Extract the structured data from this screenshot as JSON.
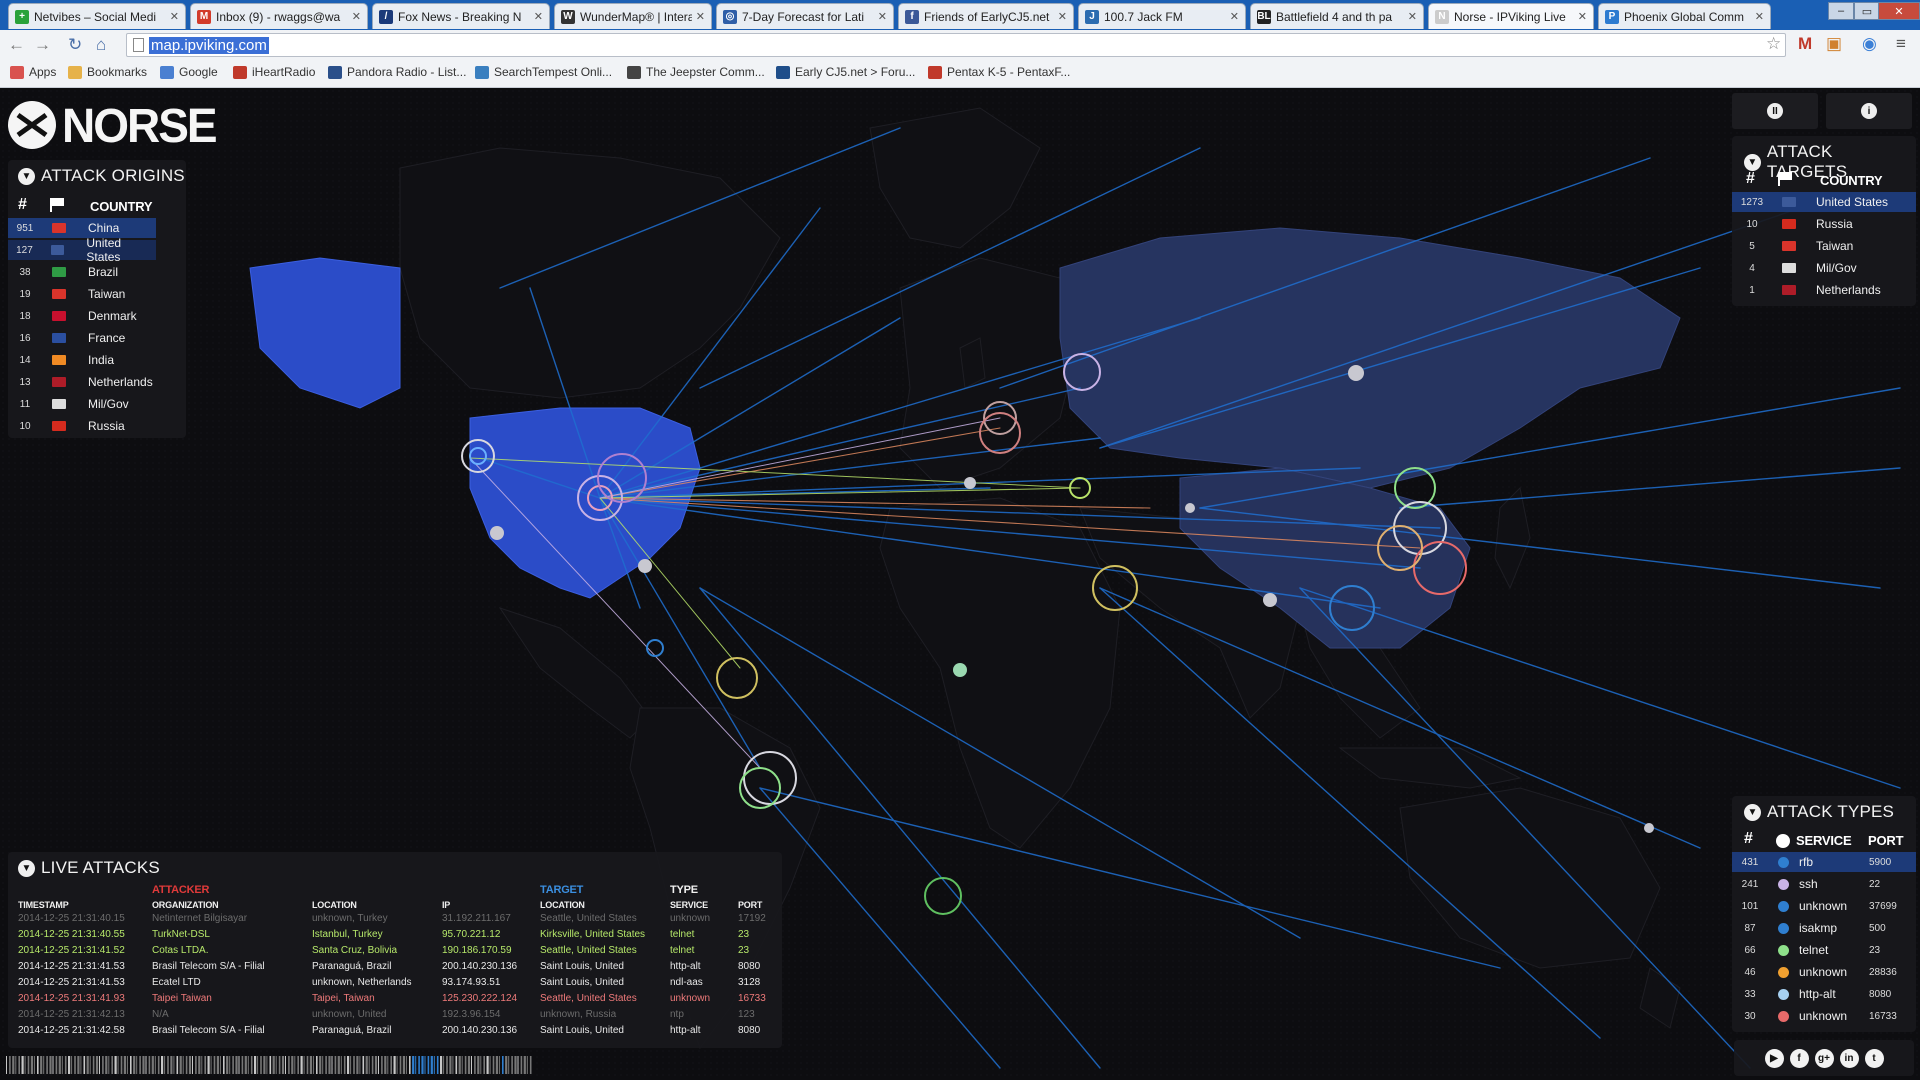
{
  "browser": {
    "tabs": [
      {
        "title": "Netvibes – Social Medi",
        "fav_color": "#2aa23a",
        "fav_glyph": "+"
      },
      {
        "title": "Inbox (9) - rwaggs@wa",
        "fav_color": "#d23b2a",
        "fav_glyph": "M"
      },
      {
        "title": "Fox News - Breaking N",
        "fav_color": "#1b3a7a",
        "fav_glyph": "/"
      },
      {
        "title": "WunderMap® | Interac",
        "fav_color": "#333333",
        "fav_glyph": "W"
      },
      {
        "title": "7-Day Forecast for Lati",
        "fav_color": "#2f5fa8",
        "fav_glyph": "◎"
      },
      {
        "title": "Friends of EarlyCJ5.net",
        "fav_color": "#3b5998",
        "fav_glyph": "f"
      },
      {
        "title": "100.7 Jack FM",
        "fav_color": "#2b6cb0",
        "fav_glyph": "J"
      },
      {
        "title": "Battlefield 4 and th pa",
        "fav_color": "#222222",
        "fav_glyph": "BL"
      },
      {
        "title": "Norse - IPViking Live",
        "fav_color": "#cccccc",
        "fav_glyph": "N"
      },
      {
        "title": "Phoenix Global Comm",
        "fav_color": "#2c7bd0",
        "fav_glyph": "P"
      }
    ],
    "url": "map.ipviking.com",
    "bookmarks": [
      {
        "label": "Apps",
        "color": "#d9534f"
      },
      {
        "label": "Bookmarks",
        "color": "#e6b24a"
      },
      {
        "label": "Google",
        "color": "#4a7fd1"
      },
      {
        "label": "iHeartRadio",
        "color": "#c0392b"
      },
      {
        "label": "Pandora Radio - List...",
        "color": "#2a4f8a"
      },
      {
        "label": "SearchTempest Onli...",
        "color": "#3a7fbf"
      },
      {
        "label": "The Jeepster Comm...",
        "color": "#444444"
      },
      {
        "label": "Early CJ5.net > Foru...",
        "color": "#1f4e8a"
      },
      {
        "label": "Pentax K-5 - PentaxF...",
        "color": "#c0392b"
      }
    ]
  },
  "logo": "NORSE",
  "origins": {
    "title": "ATTACK ORIGINS",
    "col_num": "#",
    "col_country": "COUNTRY",
    "rows": [
      {
        "count": "951",
        "country": "China",
        "flag": "#d9342b"
      },
      {
        "count": "127",
        "country": "United States",
        "flag": "#3c5a9a"
      },
      {
        "count": "38",
        "country": "Brazil",
        "flag": "#2f9b45"
      },
      {
        "count": "19",
        "country": "Taiwan",
        "flag": "#d9342b"
      },
      {
        "count": "18",
        "country": "Denmark",
        "flag": "#c8102e"
      },
      {
        "count": "16",
        "country": "France",
        "flag": "#2b4fa0"
      },
      {
        "count": "14",
        "country": "India",
        "flag": "#f08a24"
      },
      {
        "count": "13",
        "country": "Netherlands",
        "flag": "#ae1c28"
      },
      {
        "count": "11",
        "country": "Mil/Gov",
        "flag": "#dddddd"
      },
      {
        "count": "10",
        "country": "Russia",
        "flag": "#d52b1e"
      }
    ]
  },
  "targets": {
    "title": "ATTACK TARGETS",
    "col_num": "#",
    "col_country": "COUNTRY",
    "rows": [
      {
        "count": "1273",
        "country": "United States",
        "flag": "#3c5a9a"
      },
      {
        "count": "10",
        "country": "Russia",
        "flag": "#d52b1e"
      },
      {
        "count": "5",
        "country": "Taiwan",
        "flag": "#d9342b"
      },
      {
        "count": "4",
        "country": "Mil/Gov",
        "flag": "#dddddd"
      },
      {
        "count": "1",
        "country": "Netherlands",
        "flag": "#ae1c28"
      }
    ]
  },
  "types": {
    "title": "ATTACK TYPES",
    "col_num": "#",
    "col_service": "SERVICE",
    "col_port": "PORT",
    "rows": [
      {
        "count": "431",
        "service": "rfb",
        "port": "5900",
        "color": "#2f7fd0"
      },
      {
        "count": "241",
        "service": "ssh",
        "port": "22",
        "color": "#c9b3e6"
      },
      {
        "count": "101",
        "service": "unknown",
        "port": "37699",
        "color": "#2f7fd0"
      },
      {
        "count": "87",
        "service": "isakmp",
        "port": "500",
        "color": "#2f7fd0"
      },
      {
        "count": "66",
        "service": "telnet",
        "port": "23",
        "color": "#8ee08a"
      },
      {
        "count": "46",
        "service": "unknown",
        "port": "28836",
        "color": "#f0a030"
      },
      {
        "count": "33",
        "service": "http-alt",
        "port": "8080",
        "color": "#a6d0f0"
      },
      {
        "count": "30",
        "service": "unknown",
        "port": "16733",
        "color": "#e86a6a"
      }
    ]
  },
  "live": {
    "title": "LIVE ATTACKS",
    "attacker_label": "ATTACKER",
    "target_label": "TARGET",
    "type_label": "TYPE",
    "headers": {
      "timestamp": "TIMESTAMP",
      "organization": "ORGANIZATION",
      "location": "LOCATION",
      "ip": "IP",
      "tlocation": "LOCATION",
      "service": "SERVICE",
      "port": "PORT"
    },
    "rows": [
      {
        "timestamp": "2014-12-25  21:31:40.15",
        "organization": "Netinternet Bilgisayar",
        "location": "unknown, Turkey",
        "ip": "31.192.211.167",
        "tlocation": "Seattle, United States",
        "service": "unknown",
        "port": "17192",
        "color": "#6c6c6c"
      },
      {
        "timestamp": "2014-12-25  21:31:40.55",
        "organization": "TurkNet-DSL",
        "location": "Istanbul, Turkey",
        "ip": "95.70.221.12",
        "tlocation": "Kirksville, United States",
        "service": "telnet",
        "port": "23",
        "color": "#b6e86a"
      },
      {
        "timestamp": "2014-12-25  21:31:41.52",
        "organization": "Cotas LTDA.",
        "location": "Santa Cruz, Bolivia",
        "ip": "190.186.170.59",
        "tlocation": "Seattle, United States",
        "service": "telnet",
        "port": "23",
        "color": "#b6e86a"
      },
      {
        "timestamp": "2014-12-25  21:31:41.53",
        "organization": "Brasil Telecom S/A - Filial",
        "location": "Paranaguá, Brazil",
        "ip": "200.140.230.136",
        "tlocation": "Saint Louis, United",
        "service": "http-alt",
        "port": "8080",
        "color": "#e8e8e8"
      },
      {
        "timestamp": "2014-12-25  21:31:41.53",
        "organization": "Ecatel LTD",
        "location": "unknown, Netherlands",
        "ip": "93.174.93.51",
        "tlocation": "Saint Louis, United",
        "service": "ndl-aas",
        "port": "3128",
        "color": "#e8e8e8"
      },
      {
        "timestamp": "2014-12-25  21:31:41.93",
        "organization": "Taipei Taiwan",
        "location": "Taipei, Taiwan",
        "ip": "125.230.222.124",
        "tlocation": "Seattle, United States",
        "service": "unknown",
        "port": "16733",
        "color": "#ef7a7a"
      },
      {
        "timestamp": "2014-12-25  21:31:42.13",
        "organization": "N/A",
        "location": "unknown, United",
        "ip": "192.3.96.154",
        "tlocation": "unknown, Russia",
        "service": "ntp",
        "port": "123",
        "color": "#6c6c6c"
      },
      {
        "timestamp": "2014-12-25  21:31:42.58",
        "organization": "Brasil Telecom S/A - Filial",
        "location": "Paranaguá, Brazil",
        "ip": "200.140.230.136",
        "tlocation": "Saint Louis, United",
        "service": "http-alt",
        "port": "8080",
        "color": "#e8e8e8"
      }
    ]
  },
  "social": [
    "youtube",
    "facebook",
    "google-plus",
    "linkedin",
    "twitter"
  ]
}
